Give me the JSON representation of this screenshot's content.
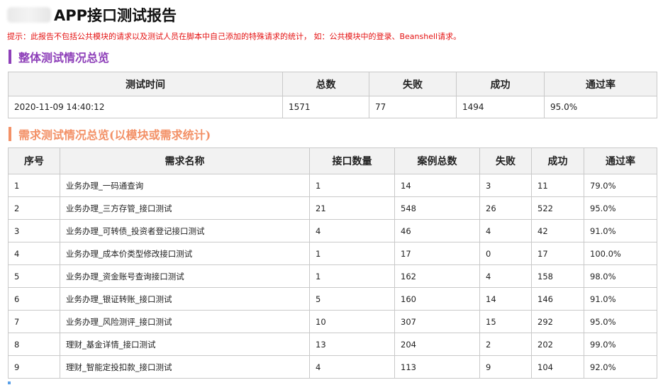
{
  "header": {
    "title": "APP接口测试报告",
    "tip": "提示：此报告不包括公共模块的请求以及测试人员在脚本中自己添加的特殊请求的统计， 如：公共模块中的登录、Beanshell请求。"
  },
  "overall": {
    "heading": "整体测试情况总览",
    "columns": [
      "测试时间",
      "总数",
      "失败",
      "成功",
      "通过率"
    ],
    "row": [
      "2020-11-09 14:40:12",
      "1571",
      "77",
      "1494",
      "95.0%"
    ]
  },
  "detail": {
    "heading": "需求测试情况总览(以模块或需求统计)",
    "columns": [
      "序号",
      "需求名称",
      "接口数量",
      "案例总数",
      "失败",
      "成功",
      "通过率"
    ],
    "rows": [
      [
        "1",
        "业务办理_一码通查询",
        "1",
        "14",
        "3",
        "11",
        "79.0%"
      ],
      [
        "2",
        "业务办理_三方存管_接口测试",
        "21",
        "548",
        "26",
        "522",
        "95.0%"
      ],
      [
        "3",
        "业务办理_可转债_投资者登记接口测试",
        "4",
        "46",
        "4",
        "42",
        "91.0%"
      ],
      [
        "4",
        "业务办理_成本价类型修改接口测试",
        "1",
        "17",
        "0",
        "17",
        "100.0%"
      ],
      [
        "5",
        "业务办理_资金账号查询接口测试",
        "1",
        "162",
        "4",
        "158",
        "98.0%"
      ],
      [
        "6",
        "业务办理_银证转账_接口测试",
        "5",
        "160",
        "14",
        "146",
        "91.0%"
      ],
      [
        "7",
        "业务办理_风险测评_接口测试",
        "10",
        "307",
        "15",
        "292",
        "95.0%"
      ],
      [
        "8",
        "理财_基金详情_接口测试",
        "13",
        "204",
        "2",
        "202",
        "99.0%"
      ],
      [
        "9",
        "理财_智能定投扣款_接口测试",
        "4",
        "113",
        "9",
        "104",
        "92.0%"
      ]
    ]
  }
}
